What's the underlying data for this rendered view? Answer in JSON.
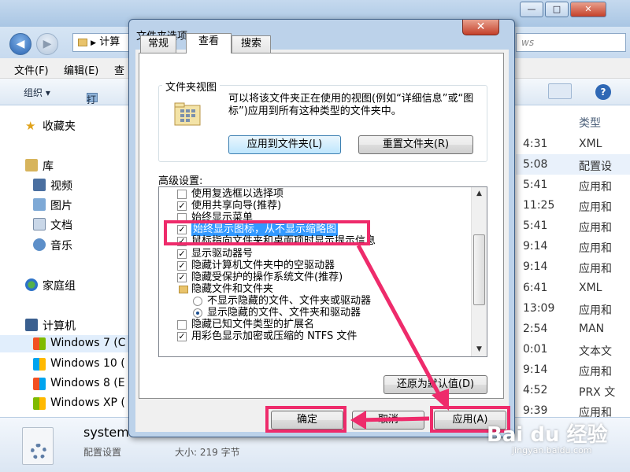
{
  "explorer": {
    "address_text": "计算",
    "search_placeholder": "ws",
    "menu": [
      "文件(F)",
      "编辑(E)",
      "查"
    ],
    "toolbar": {
      "organize": "组织 ▾",
      "open": "打开"
    },
    "nav": {
      "favorites": "收藏夹",
      "libraries": "库",
      "videos": "视频",
      "pictures": "图片",
      "documents": "文档",
      "music": "音乐",
      "homegroup": "家庭组",
      "computer": "计算机",
      "drives": [
        "Windows 7 (C",
        "Windows 10 (",
        "Windows 8 (E",
        "Windows XP ("
      ]
    },
    "column_header": "类型",
    "times": [
      "4:31",
      "5:08",
      "5:41",
      "11:25",
      "5:41",
      "9:14",
      "9:14",
      "6:41",
      "13:09",
      "2:54",
      "0:01",
      "9:14",
      "4:52",
      "9:39"
    ],
    "types": [
      "XML",
      "配置设",
      "应用和",
      "应用和",
      "应用和",
      "应用和",
      "应用和",
      "XML",
      "应用和",
      "MAN",
      "文本文",
      "应用和",
      "PRX 文",
      "应用和"
    ],
    "status": {
      "filename": "system",
      "filetype": "配置设置",
      "filesize": "大小: 219 字节"
    },
    "window_buttons": [
      "—",
      "□",
      "✕"
    ]
  },
  "dialog": {
    "title": "文件夹选项",
    "close": "✕",
    "tabs": [
      "常规",
      "查看",
      "搜索"
    ],
    "active_tab": "查看",
    "folder_views": {
      "label": "文件夹视图",
      "description": "可以将该文件夹正在使用的视图(例如“详细信息”或“图标”)应用到所有这种类型的文件夹中。",
      "apply_button": "应用到文件夹(L)",
      "reset_button": "重置文件夹(R)"
    },
    "advanced": {
      "label": "高级设置:",
      "items": [
        {
          "text": "使用复选框以选择项",
          "type": "checkbox",
          "checked": false
        },
        {
          "text": "使用共享向导(推荐)",
          "type": "checkbox",
          "checked": true
        },
        {
          "text": "始终显示菜单",
          "type": "checkbox",
          "checked": false
        },
        {
          "text": "始终显示图标，从不显示缩略图",
          "type": "checkbox",
          "checked": true,
          "selected": true
        },
        {
          "text": "鼠标指向文件夹和桌面项时显示提示信息",
          "type": "checkbox",
          "checked": true
        },
        {
          "text": "显示驱动器号",
          "type": "checkbox",
          "checked": true
        },
        {
          "text": "隐藏计算机文件夹中的空驱动器",
          "type": "checkbox",
          "checked": true
        },
        {
          "text": "隐藏受保护的操作系统文件(推荐)",
          "type": "checkbox",
          "checked": true
        },
        {
          "text": "隐藏文件和文件夹",
          "type": "folder"
        },
        {
          "text": "不显示隐藏的文件、文件夹或驱动器",
          "type": "radio",
          "checked": false
        },
        {
          "text": "显示隐藏的文件、文件夹和驱动器",
          "type": "radio",
          "checked": true
        },
        {
          "text": "隐藏已知文件类型的扩展名",
          "type": "checkbox",
          "checked": false
        },
        {
          "text": "用彩色显示加密或压缩的 NTFS 文件",
          "type": "checkbox",
          "checked": true
        }
      ],
      "restore_button": "还原为默认值(D)"
    },
    "ok_button": "确定",
    "cancel_button": "取消",
    "apply_button": "应用(A)"
  },
  "watermark": {
    "brand": "Bai du 经验",
    "sub": "jingyan.baidu.com"
  },
  "colors": {
    "annotation": "#ee2b6b",
    "selection": "#3399ff",
    "dialog_frame": "#bcd2ea"
  }
}
